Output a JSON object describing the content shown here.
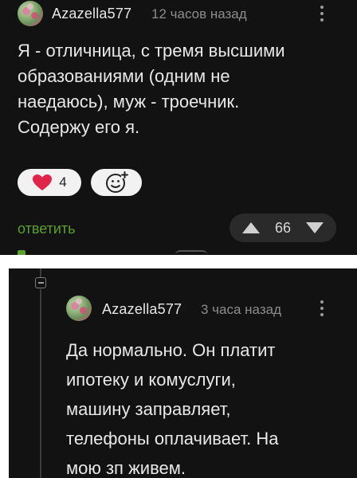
{
  "comment": {
    "author": "Azazella577",
    "time": "12 часов назад",
    "text": "Я - отличница, с тремя высшими\nобразованиями (одним не\nнаедаюсь), муж - троечник.\nСодержу его я.",
    "likes": "4",
    "reply_label": "ответить",
    "votes": "66",
    "like_color": "#e0244a",
    "reply_color": "#5aa02c"
  },
  "reply": {
    "author": "Azazella577",
    "time": "3 часа назад",
    "text": "Да нормально. Он платит\nипотеку и комуслуги,\nмашину заправляет,\nтелефоны оплачивает. На\nмою зп живем."
  },
  "icons": {
    "menu": "more-vertical-icon",
    "like": "heart-icon",
    "emoji": "add-reaction-icon",
    "upvote": "triangle-up-icon",
    "downvote": "triangle-down-icon",
    "collapse": "collapse-minus-icon"
  }
}
